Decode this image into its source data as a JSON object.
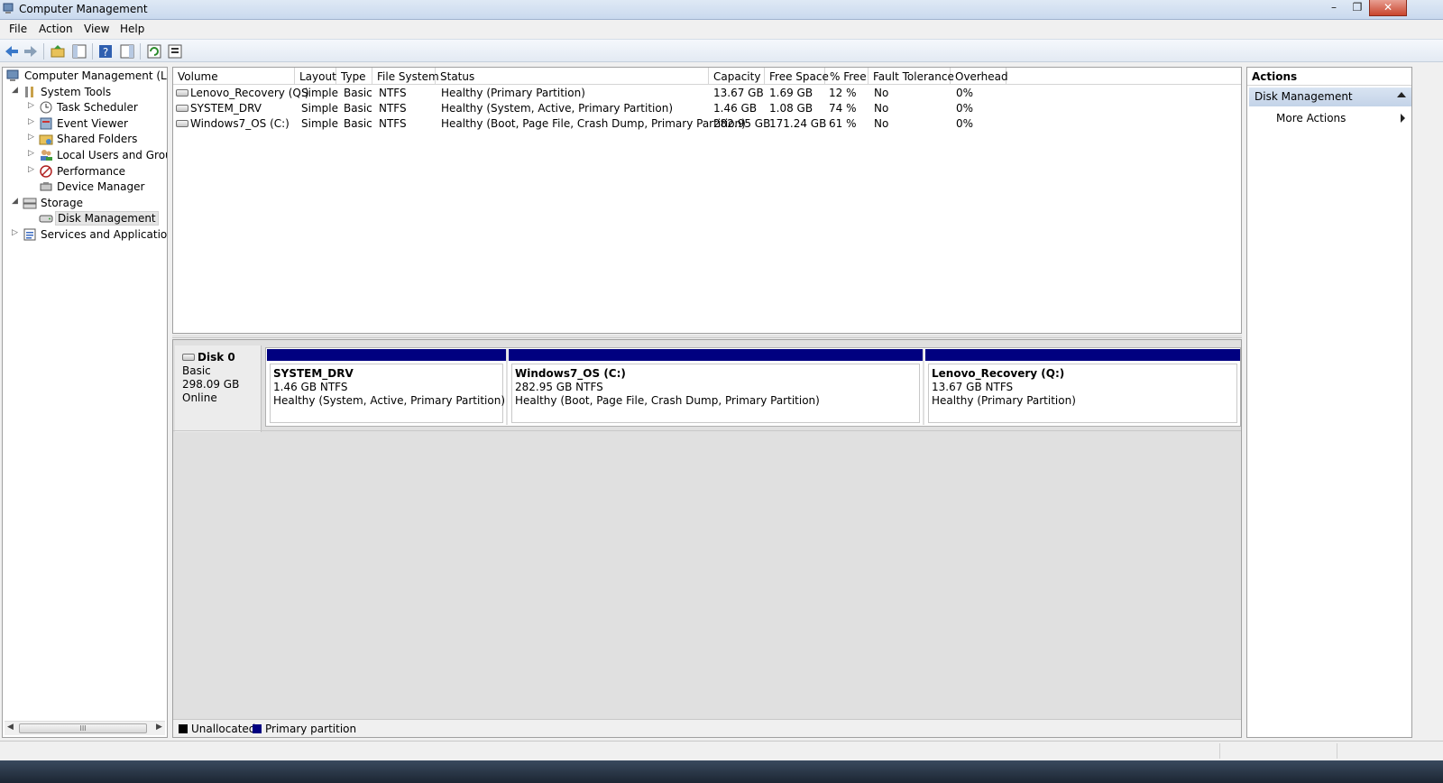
{
  "window": {
    "title": "Computer Management",
    "controls": {
      "minimize": "–",
      "maximize": "❐",
      "close": "✕"
    }
  },
  "menu": [
    "File",
    "Action",
    "View",
    "Help"
  ],
  "toolbar_icons": [
    "back-arrow-icon",
    "forward-arrow-icon",
    "up-folder-icon",
    "show-hide-tree-icon",
    "help-icon",
    "show-hide-action-pane-icon",
    "refresh-icon",
    "properties-icon"
  ],
  "tree": {
    "root": "Computer Management (Local",
    "items": [
      {
        "label": "System Tools",
        "expander": "◢",
        "icon": "tools-icon"
      },
      {
        "label": "Task Scheduler",
        "expander": "▷",
        "icon": "clock-icon"
      },
      {
        "label": "Event Viewer",
        "expander": "▷",
        "icon": "event-viewer-icon"
      },
      {
        "label": "Shared Folders",
        "expander": "▷",
        "icon": "shared-folder-icon"
      },
      {
        "label": "Local Users and Groups",
        "expander": "▷",
        "icon": "users-icon"
      },
      {
        "label": "Performance",
        "expander": "▷",
        "icon": "performance-icon"
      },
      {
        "label": "Device Manager",
        "expander": "",
        "icon": "device-manager-icon"
      },
      {
        "label": "Storage",
        "expander": "◢",
        "icon": "storage-icon"
      },
      {
        "label": "Disk Management",
        "expander": "",
        "icon": "disk-management-icon"
      },
      {
        "label": "Services and Applications",
        "expander": "▷",
        "icon": "services-icon"
      }
    ],
    "scroll_left": "◀",
    "scroll_right": "▶",
    "scroll_grip": "III"
  },
  "volumes": {
    "columns": [
      "Volume",
      "Layout",
      "Type",
      "File System",
      "Status",
      "Capacity",
      "Free Space",
      "% Free",
      "Fault Tolerance",
      "Overhead"
    ],
    "rows": [
      [
        "Lenovo_Recovery (Q:)",
        "Simple",
        "Basic",
        "NTFS",
        "Healthy (Primary Partition)",
        "13.67 GB",
        "1.69 GB",
        "12 %",
        "No",
        "0%"
      ],
      [
        "SYSTEM_DRV",
        "Simple",
        "Basic",
        "NTFS",
        "Healthy (System, Active, Primary Partition)",
        "1.46 GB",
        "1.08 GB",
        "74 %",
        "No",
        "0%"
      ],
      [
        "Windows7_OS (C:)",
        "Simple",
        "Basic",
        "NTFS",
        "Healthy (Boot, Page File, Crash Dump, Primary Partition)",
        "282.95 GB",
        "171.24 GB",
        "61 %",
        "No",
        "0%"
      ]
    ]
  },
  "disk": {
    "name": "Disk 0",
    "type": "Basic",
    "size": "298.09 GB",
    "state": "Online",
    "partitions": [
      {
        "name": "SYSTEM_DRV",
        "size": "1.46 GB NTFS",
        "status": "Healthy (System, Active, Primary Partition)"
      },
      {
        "name": "Windows7_OS  (C:)",
        "size": "282.95 GB NTFS",
        "status": "Healthy (Boot, Page File, Crash Dump, Primary Partition)"
      },
      {
        "name": "Lenovo_Recovery  (Q:)",
        "size": "13.67 GB NTFS",
        "status": "Healthy (Primary Partition)"
      }
    ]
  },
  "legend": [
    {
      "label": "Unallocated",
      "color": "#000000"
    },
    {
      "label": "Primary partition",
      "color": "#000080"
    }
  ],
  "actions": {
    "title": "Actions",
    "section": "Disk Management",
    "item": "More Actions"
  },
  "colors": {
    "primary_partition": "#000080",
    "unallocated": "#000000"
  }
}
